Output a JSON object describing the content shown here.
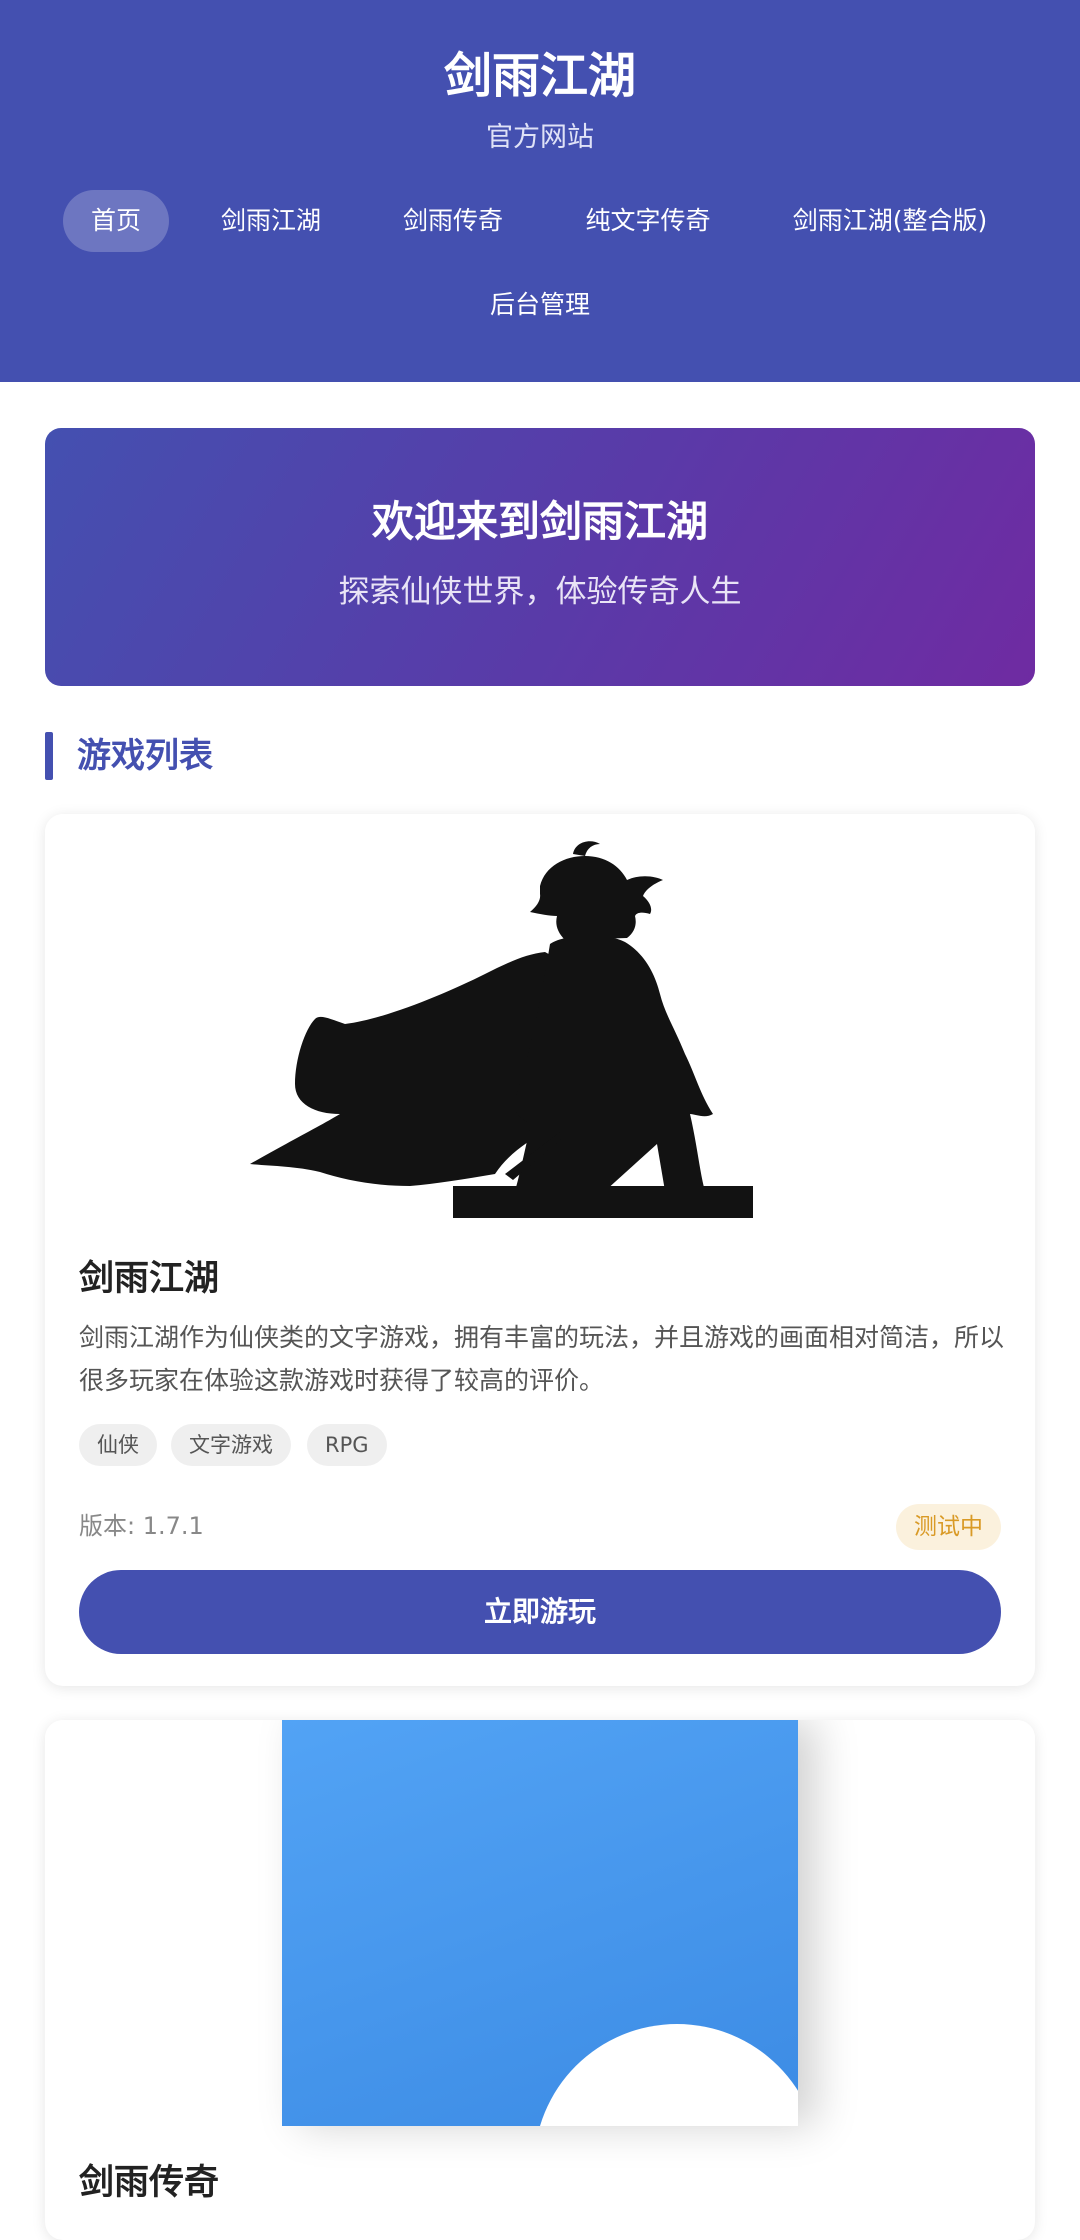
{
  "header": {
    "site_title": "剑雨江湖",
    "site_subtitle": "官方网站",
    "nav": [
      "首页",
      "剑雨江湖",
      "剑雨传奇",
      "纯文字传奇",
      "剑雨江湖(整合版)",
      "后台管理"
    ],
    "active_nav": "首页"
  },
  "hero": {
    "title": "欢迎来到剑雨江湖",
    "subtitle": "探索仙侠世界，体验传奇人生"
  },
  "section": {
    "title": "游戏列表"
  },
  "games": [
    {
      "title": "剑雨江湖",
      "description": "剑雨江湖作为仙侠类的文字游戏，拥有丰富的玩法，并且游戏的画面相对简洁，所以很多玩家在体验这款游戏时获得了较高的评价。",
      "tags": [
        "仙侠",
        "文字游戏",
        "RPG"
      ],
      "version": "版本: 1.7.1",
      "status": "测试中",
      "play_label": "立即游玩"
    },
    {
      "title": "剑雨传奇"
    }
  ],
  "colors": {
    "primary": "#4450b0",
    "hero_gradient_end": "#6f2ba2",
    "status_text": "#d99a26",
    "status_bg": "#fbf1dd"
  }
}
